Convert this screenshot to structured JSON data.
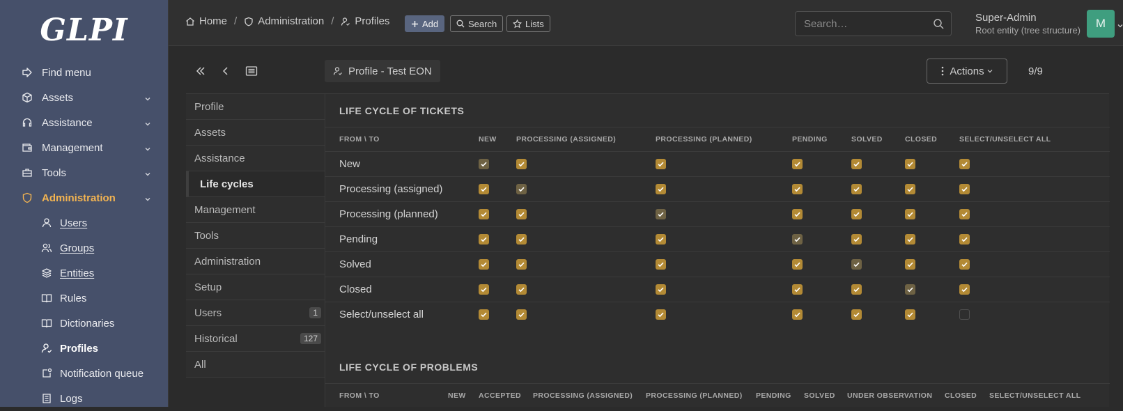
{
  "app": {
    "logo": "GLPI"
  },
  "sidebar": {
    "items": [
      {
        "label": "Find menu",
        "icon": "find-menu-icon"
      },
      {
        "label": "Assets",
        "icon": "cube-icon"
      },
      {
        "label": "Assistance",
        "icon": "headset-icon"
      },
      {
        "label": "Management",
        "icon": "wallet-icon"
      },
      {
        "label": "Tools",
        "icon": "briefcase-icon"
      },
      {
        "label": "Administration",
        "icon": "shield-icon"
      }
    ],
    "subitems": [
      {
        "label": "Users",
        "icon": "user-icon"
      },
      {
        "label": "Groups",
        "icon": "users-icon"
      },
      {
        "label": "Entities",
        "icon": "stack-icon"
      },
      {
        "label": "Rules",
        "icon": "book-icon"
      },
      {
        "label": "Dictionaries",
        "icon": "book-icon"
      },
      {
        "label": "Profiles",
        "icon": "user-check-icon"
      },
      {
        "label": "Notification queue",
        "icon": "notification-icon"
      },
      {
        "label": "Logs",
        "icon": "logs-icon"
      }
    ]
  },
  "topbar": {
    "breadcrumb": [
      "Home",
      "Administration",
      "Profiles"
    ],
    "add_label": "Add",
    "search_label": "Search",
    "lists_label": "Lists",
    "search_placeholder": "Search…",
    "user_name": "Super-Admin",
    "user_entity": "Root entity (tree structure)",
    "avatar_initial": "M"
  },
  "tabs": [
    {
      "label": "Profile"
    },
    {
      "label": "Assets"
    },
    {
      "label": "Assistance"
    },
    {
      "label": "Life cycles"
    },
    {
      "label": "Management"
    },
    {
      "label": "Tools"
    },
    {
      "label": "Administration"
    },
    {
      "label": "Setup"
    },
    {
      "label": "Users",
      "badge": "1"
    },
    {
      "label": "Historical",
      "badge": "127"
    },
    {
      "label": "All"
    }
  ],
  "page": {
    "title": "Profile - Test EON",
    "actions_label": "Actions",
    "counter": "9/9"
  },
  "tickets": {
    "title": "LIFE CYCLE OF TICKETS",
    "columns": [
      "FROM \\ TO",
      "NEW",
      "PROCESSING (ASSIGNED)",
      "PROCESSING (PLANNED)",
      "PENDING",
      "SOLVED",
      "CLOSED",
      "SELECT/UNSELECT ALL"
    ],
    "rows": [
      {
        "label": "New",
        "cells": [
          "dim",
          "on",
          "on",
          "on",
          "on",
          "on",
          "on"
        ]
      },
      {
        "label": "Processing (assigned)",
        "cells": [
          "on",
          "dim",
          "on",
          "on",
          "on",
          "on",
          "on"
        ]
      },
      {
        "label": "Processing (planned)",
        "cells": [
          "on",
          "on",
          "dim",
          "on",
          "on",
          "on",
          "on"
        ]
      },
      {
        "label": "Pending",
        "cells": [
          "on",
          "on",
          "on",
          "dim",
          "on",
          "on",
          "on"
        ]
      },
      {
        "label": "Solved",
        "cells": [
          "on",
          "on",
          "on",
          "on",
          "dim",
          "on",
          "on"
        ]
      },
      {
        "label": "Closed",
        "cells": [
          "on",
          "on",
          "on",
          "on",
          "on",
          "dim",
          "on"
        ]
      },
      {
        "label": "Select/unselect all",
        "cells": [
          "on",
          "on",
          "on",
          "on",
          "on",
          "on",
          "off"
        ]
      }
    ]
  },
  "problems": {
    "title": "LIFE CYCLE OF PROBLEMS",
    "columns": [
      "FROM \\ TO",
      "NEW",
      "ACCEPTED",
      "PROCESSING (ASSIGNED)",
      "PROCESSING (PLANNED)",
      "PENDING",
      "SOLVED",
      "UNDER OBSERVATION",
      "CLOSED",
      "SELECT/UNSELECT ALL"
    ]
  },
  "colors": {
    "sidebar": "#46506a",
    "accent": "#f3b451",
    "checkbox": "#b38a35",
    "avatar": "#3f9e7f"
  }
}
